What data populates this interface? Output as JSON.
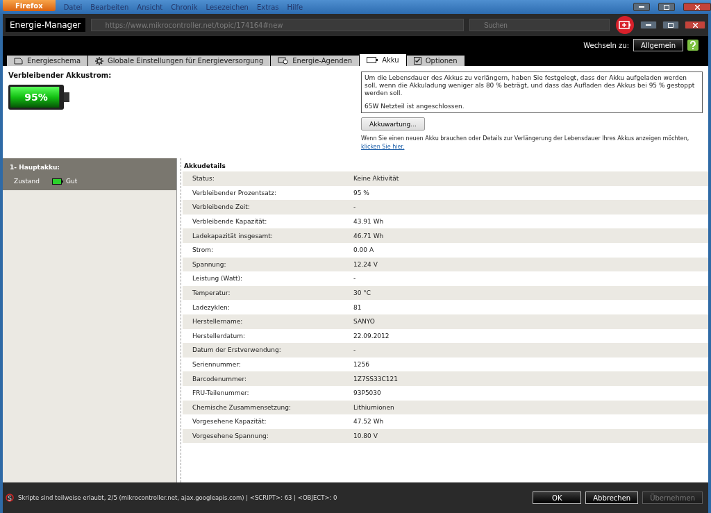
{
  "browser": {
    "app_button": "Firefox",
    "menu": [
      "Datei",
      "Bearbeiten",
      "Ansicht",
      "Chronik",
      "Lesezeichen",
      "Extras",
      "Hilfe"
    ],
    "url": "https://www.mikrocontroller.net/topic/174164#new",
    "search": {
      "placeholder": "Suchen"
    }
  },
  "window": {
    "title": "Energie-Manager"
  },
  "switch": {
    "label": "Wechseln zu:",
    "button": "Allgemein"
  },
  "tabs": [
    {
      "label": "Energieschema",
      "kind": "plan",
      "selected": false
    },
    {
      "label": "Globale Einstellungen für Energieversorgung",
      "kind": "gear",
      "selected": false
    },
    {
      "label": "Energie-Agenden",
      "kind": "clock",
      "selected": false
    },
    {
      "label": "Akku",
      "kind": "battery",
      "selected": true
    },
    {
      "label": "Optionen",
      "kind": "check",
      "selected": false
    }
  ],
  "remaining": {
    "label": "Verbleibender Akkustrom:",
    "reading": "95%",
    "level": 0.95
  },
  "info": {
    "text": "Um die Lebensdauer des Akkus zu verlängern, haben Sie festgelegt, dass der Akku aufgeladen werden soll, wenn die Akkuladung weniger als 80 % beträgt, und dass das Aufladen des Akkus bei 95 % gestoppt werden soll.",
    "adapter": "65W Netzteil ist angeschlossen."
  },
  "maintenance_button": "Akkuwartung...",
  "hint": {
    "text": "Wenn Sie einen neuen Akku brauchen oder Details zur Verlängerung der Lebensdauer Ihres Akkus anzeigen möchten,",
    "link": "klicken Sie hier."
  },
  "batteries": [
    {
      "title": "1- Hauptakku:",
      "condition_label": "Zustand",
      "condition": "Gut",
      "selected": true
    }
  ],
  "details": {
    "title": "Akkudetails",
    "rows": [
      {
        "label": "Status:",
        "value": "Keine Aktivität"
      },
      {
        "label": "Verbleibender Prozentsatz:",
        "value": "95 %"
      },
      {
        "label": "Verbleibende Zeit:",
        "value": "-"
      },
      {
        "label": "Verbleibende Kapazität:",
        "value": "43.91 Wh"
      },
      {
        "label": "Ladekapazität insgesamt:",
        "value": "46.71 Wh"
      },
      {
        "label": "Strom:",
        "value": "0.00 A"
      },
      {
        "label": "Spannung:",
        "value": "12.24 V"
      },
      {
        "label": "Leistung (Watt):",
        "value": "-"
      },
      {
        "label": "Temperatur:",
        "value": "30 °C"
      },
      {
        "label": "Ladezyklen:",
        "value": "81"
      },
      {
        "label": "Herstellername:",
        "value": "SANYO"
      },
      {
        "label": "Herstellerdatum:",
        "value": "22.09.2012"
      },
      {
        "label": "Datum der Erstverwendung:",
        "value": "-"
      },
      {
        "label": "Seriennummer:",
        "value": "1256"
      },
      {
        "label": "Barcodenummer:",
        "value": "1Z7SS33C121"
      },
      {
        "label": "FRU-Teilenummer:",
        "value": "93P5030"
      },
      {
        "label": "Chemische Zusammensetzung:",
        "value": "Lithiumionen"
      },
      {
        "label": "Vorgesehene Kapazität:",
        "value": "47.52 Wh"
      },
      {
        "label": "Vorgesehene Spannung:",
        "value": "10.80 V"
      }
    ]
  },
  "status_bar": "Skripte sind teilweise erlaubt, 2/5 (mikrocontroller.net, ajax.googleapis.com) | <SCRIPT>: 63 | <OBJECT>: 0",
  "buttons": [
    {
      "label": "OK",
      "disabled": false
    },
    {
      "label": "Abbrechen",
      "disabled": false
    },
    {
      "label": "Übernehmen",
      "disabled": true
    }
  ]
}
